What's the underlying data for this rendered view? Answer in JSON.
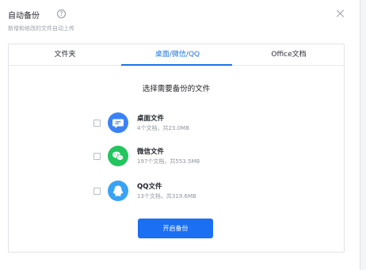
{
  "dialog": {
    "title": "自动备份",
    "subtitle": "新增和修改的文件自动上传",
    "help_icon": "question-circle-icon",
    "close_icon": "close-icon"
  },
  "tabs": [
    {
      "label": "文件夹",
      "active": false
    },
    {
      "label": "桌面/微信/QQ",
      "active": true
    },
    {
      "label": "Office文档",
      "active": false
    }
  ],
  "section_title": "选择需要备份的文件",
  "items": [
    {
      "name": "桌面文件",
      "meta": "4个文档，共23.0MB",
      "icon": "desktop-chat-icon",
      "color": "#3b82f6",
      "checked": false
    },
    {
      "name": "微信文件",
      "meta": "197个文档，共553.5MB",
      "icon": "wechat-icon",
      "color": "#22c55e",
      "checked": false
    },
    {
      "name": "QQ文件",
      "meta": "13个文档，共319.6MB",
      "icon": "qq-icon",
      "color": "#38a3f5",
      "checked": false
    }
  ],
  "start_button": "开启备份",
  "colors": {
    "accent": "#1a74e8",
    "button": "#1b6ff3"
  }
}
